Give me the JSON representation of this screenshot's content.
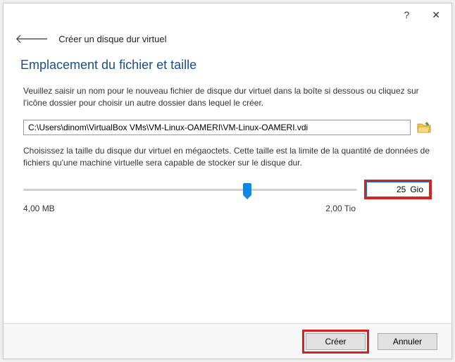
{
  "header": {
    "title": "Créer un disque dur virtuel"
  },
  "section": {
    "heading": "Emplacement du fichier et taille",
    "desc1": "Veuillez saisir un nom pour le nouveau fichier de disque dur virtuel dans la boîte si dessous ou cliquez sur l'icône dossier pour choisir un autre dossier dans lequel le créer.",
    "desc2": "Choisissez la taille du disque dur virtuel en mégaoctets. Cette taille est la limite de la quantité de données de fichiers qu'une machine virtuelle sera capable de stocker sur le disque dur."
  },
  "path": {
    "value": "C:\\Users\\dinom\\VirtualBox VMs\\VM-Linux-OAMERI\\VM-Linux-OAMERI.vdi"
  },
  "size": {
    "value": "25",
    "unit": "Gio",
    "min_label": "4,00 MB",
    "max_label": "2,00 Tio",
    "thumb_percent": 67
  },
  "footer": {
    "create": "Créer",
    "cancel": "Annuler"
  }
}
